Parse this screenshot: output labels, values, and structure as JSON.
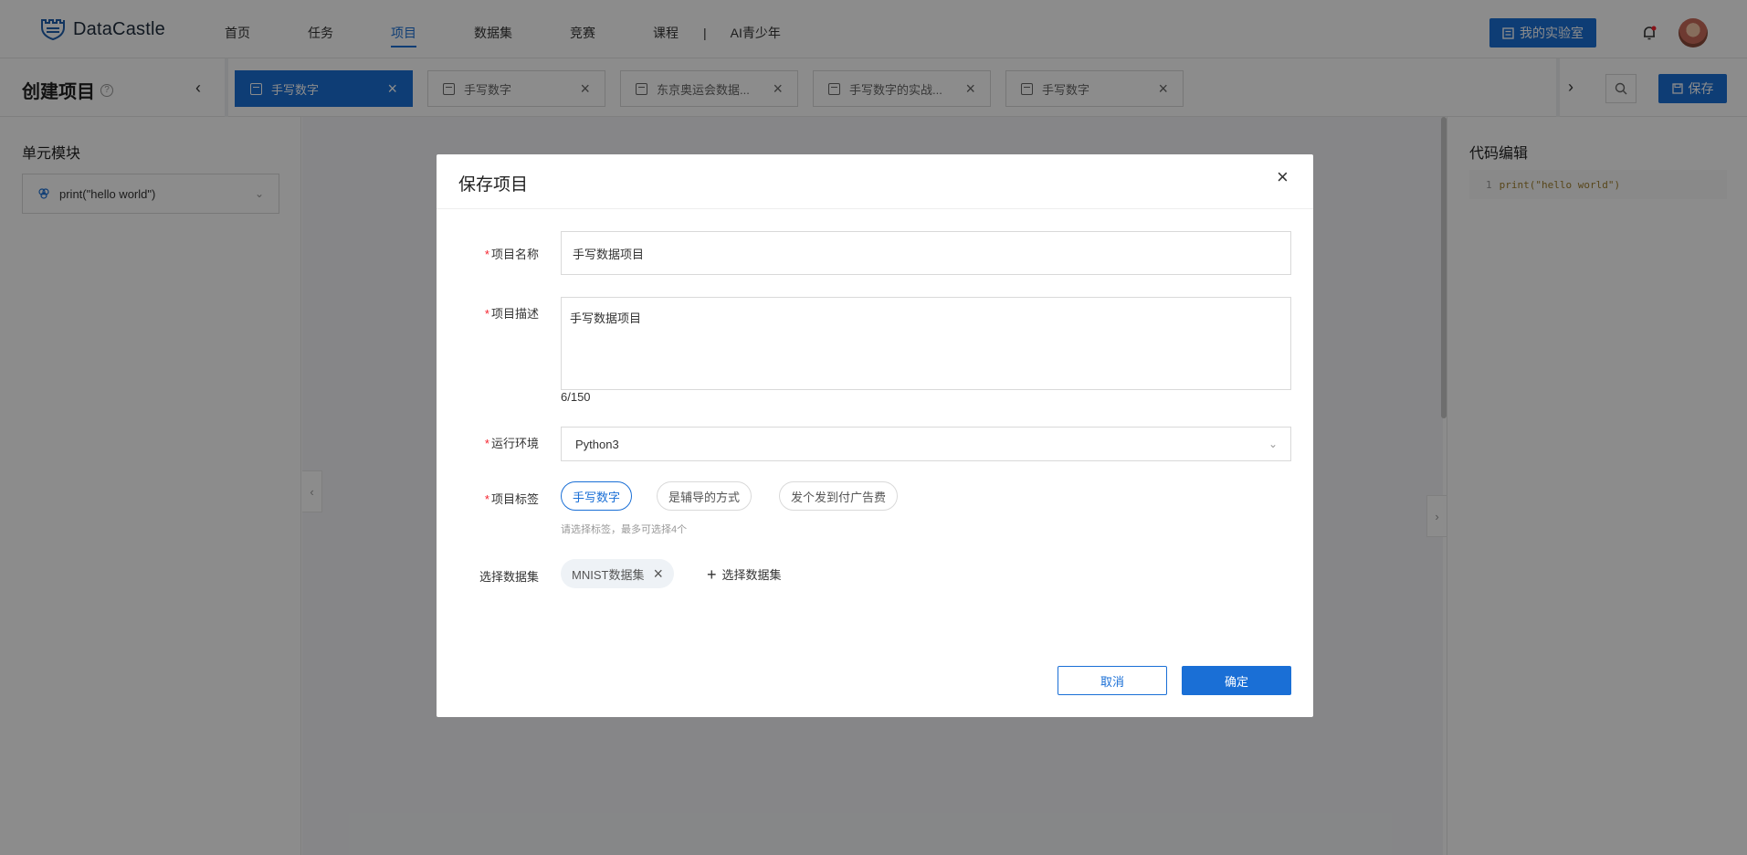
{
  "brand": {
    "name": "DataCastle"
  },
  "nav": {
    "items": [
      {
        "label": "首页",
        "active": false
      },
      {
        "label": "任务",
        "active": false
      },
      {
        "label": "项目",
        "active": true
      },
      {
        "label": "数据集",
        "active": false
      },
      {
        "label": "竞赛",
        "active": false
      },
      {
        "label": "课程",
        "active": false
      }
    ],
    "separator": "|",
    "extra": "AI青少年",
    "lab_button": "我的实验室"
  },
  "toolbar": {
    "page_title": "创建项目",
    "help": "?",
    "tabs": [
      {
        "label": "手写数字",
        "active": true
      },
      {
        "label": "手写数字",
        "active": false
      },
      {
        "label": "东京奥运会数据...",
        "active": false
      },
      {
        "label": "手写数字的实战...",
        "active": false
      },
      {
        "label": "手写数字",
        "active": false
      }
    ],
    "save_label": "保存"
  },
  "left_panel": {
    "title": "单元模块",
    "module_value": "print(\"hello world\")"
  },
  "right_panel": {
    "title": "代码编辑",
    "code_line_number": "1",
    "code_line": "print(\"hello world\")"
  },
  "modal": {
    "title": "保存项目",
    "fields": {
      "name_label": "项目名称",
      "name_value": "手写数据项目",
      "desc_label": "项目描述",
      "desc_value": "手写数据项目",
      "desc_counter": "6/150",
      "env_label": "运行环境",
      "env_value": "Python3",
      "tags_label": "项目标签",
      "tags": [
        {
          "label": "手写数字",
          "selected": true
        },
        {
          "label": "是辅导的方式",
          "selected": false
        },
        {
          "label": "发个发到付广告费",
          "selected": false
        }
      ],
      "tags_hint": "请选择标签，最多可选择4个",
      "dataset_label": "选择数据集",
      "dataset_chip": "MNIST数据集",
      "add_dataset": "选择数据集"
    },
    "cancel_label": "取消",
    "ok_label": "确定"
  },
  "colors": {
    "primary": "#1a6fd6",
    "required": "#f5222d"
  }
}
